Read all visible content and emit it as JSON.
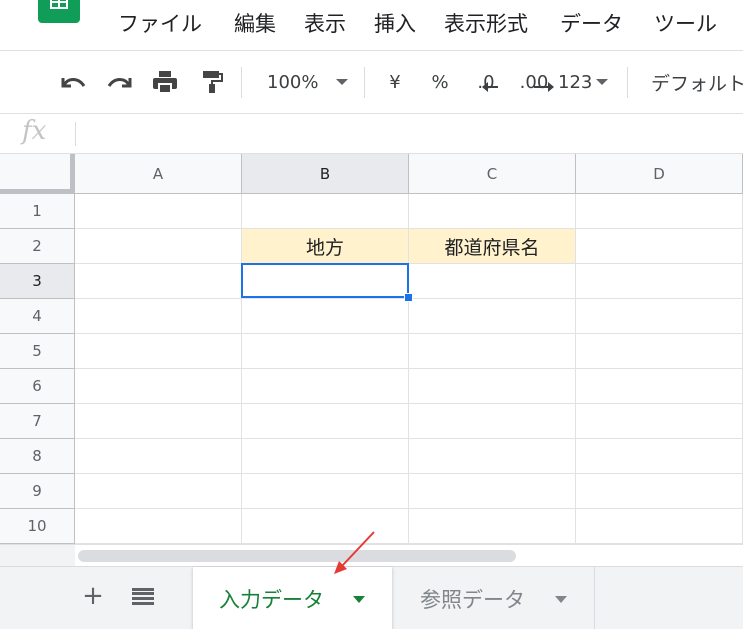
{
  "menu": {
    "file": "ファイル",
    "edit": "編集",
    "view": "表示",
    "insert": "挿入",
    "format": "表示形式",
    "data": "データ",
    "tools": "ツール"
  },
  "toolbar": {
    "zoom": "100%",
    "currency": "¥",
    "percent": "%",
    "decrease_decimal": ".0",
    "increase_decimal": ".00",
    "number_format": "123",
    "font": "デフォルト"
  },
  "formula_bar": {
    "icon_label": "fx",
    "value": ""
  },
  "grid": {
    "columns": [
      "A",
      "B",
      "C",
      "D"
    ],
    "rows": [
      "1",
      "2",
      "3",
      "4",
      "5",
      "6",
      "7",
      "8",
      "9",
      "10"
    ],
    "cells": {
      "B2": "地方",
      "C2": "都道府県名"
    },
    "selected_cell": "B3",
    "highlight_color": "#fff2cc",
    "selection_color": "#1a73e8"
  },
  "sheet_tabs": {
    "tabs": [
      {
        "label": "入力データ",
        "active": true
      },
      {
        "label": "参照データ",
        "active": false
      }
    ],
    "active_color": "#188038"
  },
  "icons": {
    "undo": "undo-icon",
    "redo": "redo-icon",
    "print": "print-icon",
    "paint_format": "paint-format-icon",
    "add_sheet": "plus-icon",
    "all_sheets": "list-icon",
    "annotation": "red-arrow-icon"
  }
}
